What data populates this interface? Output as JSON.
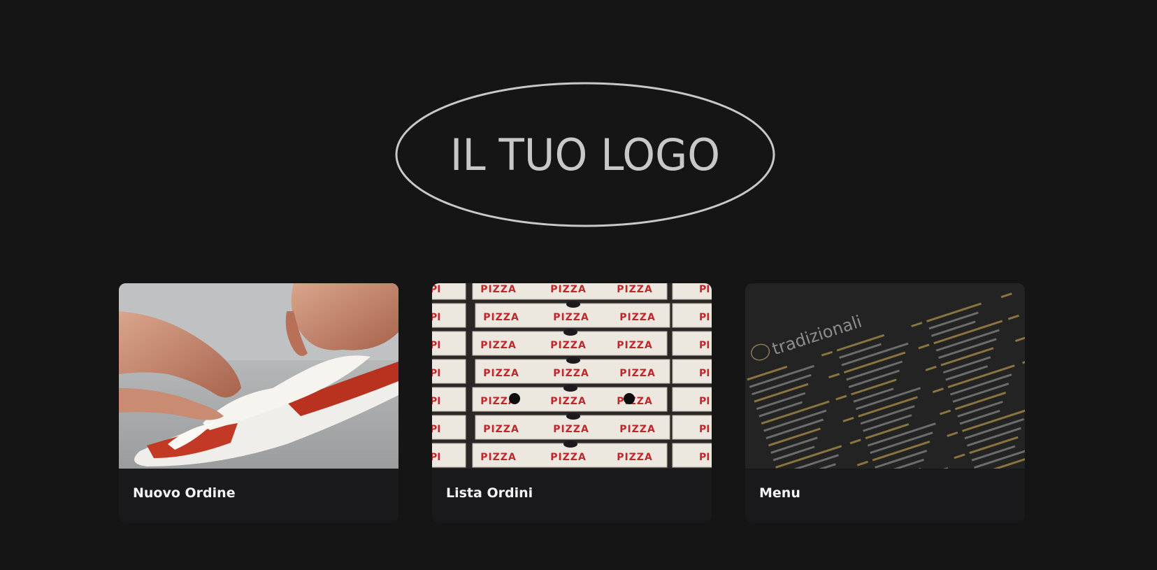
{
  "logo": {
    "text": "IL TUO LOGO"
  },
  "cards": [
    {
      "title": "Nuovo Ordine",
      "image": "hands-making-pizza-photo"
    },
    {
      "title": "Lista Ordini",
      "image": "stacked-pizza-boxes-photo",
      "box_label": "PIZZA"
    },
    {
      "title": "Menu",
      "image": "dark-menu-board-photo",
      "menu_heading": "tradizionali"
    }
  ],
  "colors": {
    "background": "#151516",
    "card": "#19191b",
    "logo": "#c8c8c8",
    "box_print": "#c0262b"
  }
}
